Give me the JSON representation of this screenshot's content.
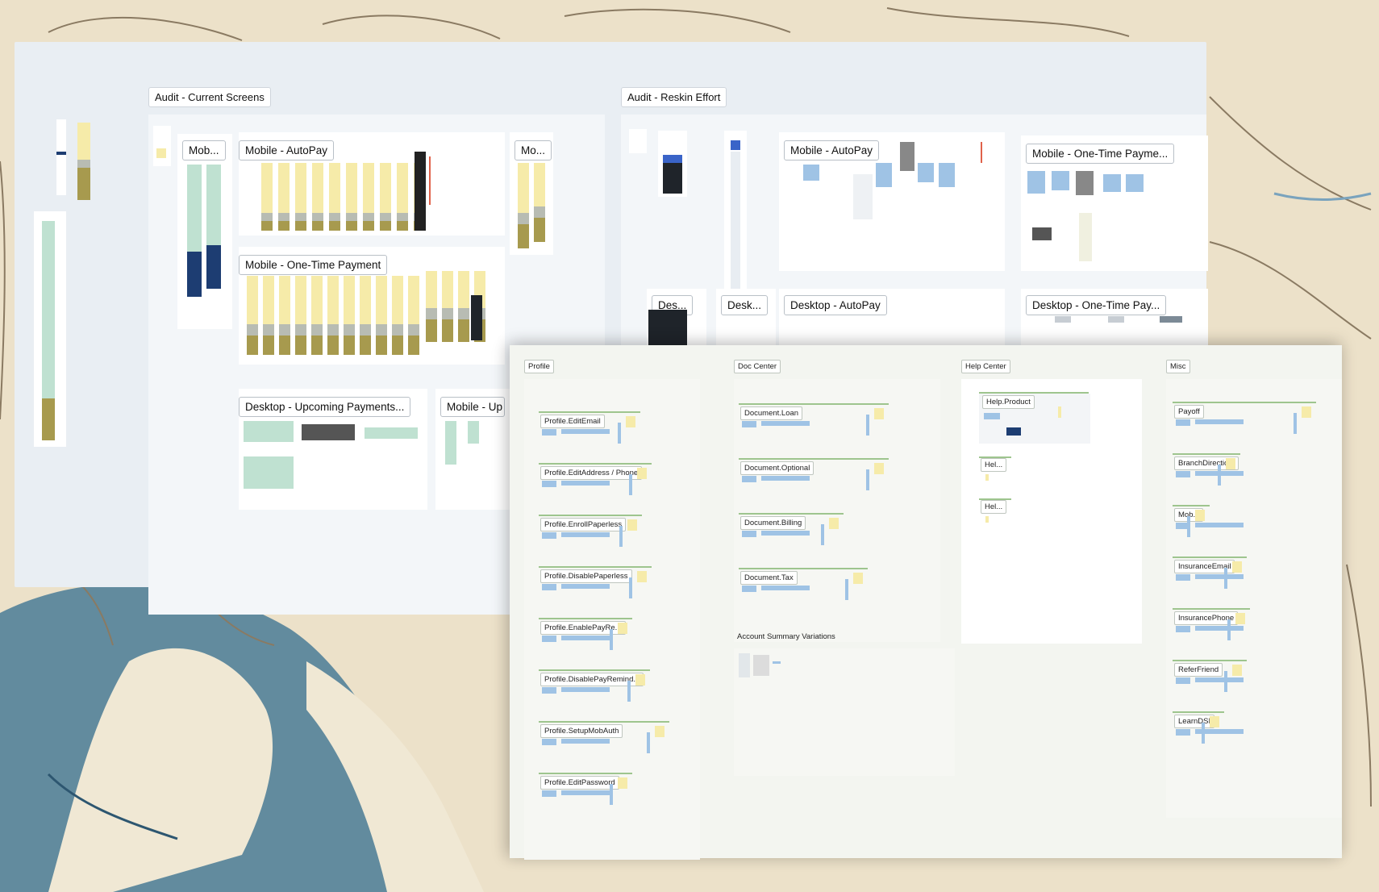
{
  "background": {
    "colors": [
      "#e9dcc3",
      "#3f6f8c",
      "#f3eedf"
    ]
  },
  "audit_current": {
    "title": "Audit - Current Screens",
    "frames": {
      "mob_short": "Mob...",
      "mobile_autopay": "Mobile - AutoPay",
      "mo_short": "Mo...",
      "mobile_one_time": "Mobile - One-Time Payment",
      "desktop_upcoming": "Desktop - Upcoming Payments...",
      "mobile_up": "Mobile - Up"
    }
  },
  "audit_reskin": {
    "title": "Audit - Reskin Effort",
    "frames": {
      "mobile_autopay": "Mobile - AutoPay",
      "mobile_one_time": "Mobile - One-Time Payme...",
      "des_short": "Des...",
      "desk_short": "Desk...",
      "desktop_autopay": "Desktop - AutoPay",
      "desktop_one_time": "Desktop - One-Time Pay..."
    }
  },
  "sections": {
    "profile": {
      "title": "Profile",
      "items": [
        "Profile.EditEmail",
        "Profile.EditAddress / Phone",
        "Profile.EnrollPaperless",
        "Profile.DisablePaperless",
        "Profile.EnablePayRe...",
        "Profile.DisablePayRemind...",
        "Profile.SetupMobAuth",
        "Profile.EditPassword"
      ]
    },
    "doc_center": {
      "title": "Doc Center",
      "items": [
        "Document.Loan",
        "Document.Optional",
        "Document.Billing",
        "Document.Tax"
      ],
      "sub_title": "Account Summary Variations"
    },
    "help_center": {
      "title": "Help Center",
      "items": [
        "Help.Product",
        "Hel...",
        "Hel..."
      ]
    },
    "misc": {
      "title": "Misc",
      "items": [
        "Payoff",
        "BranchDirectio...",
        "Mob...",
        "InsuranceEmail",
        "InsurancePhone",
        "ReferFriend",
        "LearnDSI"
      ]
    }
  },
  "colors": {
    "yellow": "#f6eba9",
    "olive": "#a79a4e",
    "navy": "#1d3d72",
    "mint": "#bfe1d1",
    "blue": "#9fc3e5"
  }
}
